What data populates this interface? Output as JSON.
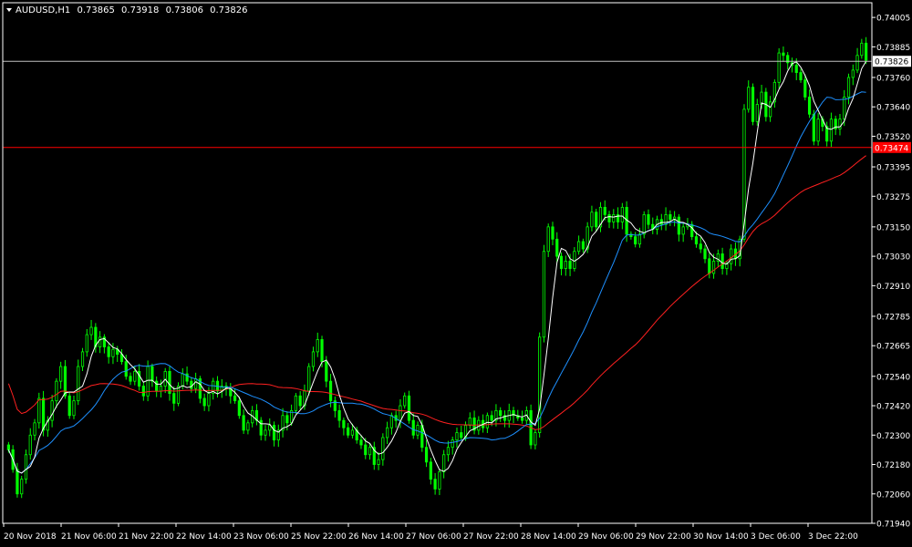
{
  "header": {
    "symbol": "AUDUSD,H1",
    "open": "0.73865",
    "high": "0.73918",
    "low": "0.73806",
    "close": "0.73826"
  },
  "colors": {
    "background": "#000000",
    "frame": "#ffffff",
    "candle": "#00ff00",
    "ma_fast": "#ffffff",
    "ma_mid": "#1e90ff",
    "ma_slow": "#ff2020",
    "hline_current": "#c0c0c0",
    "hline_level": "#ff0000"
  },
  "chart_data": {
    "type": "candlestick",
    "symbol": "AUDUSD",
    "timeframe": "H1",
    "ylim": [
      0.7194,
      0.74065
    ],
    "y_ticks": [
      "0.74005",
      "0.73885",
      "0.73760",
      "0.73640",
      "0.73520",
      "0.73395",
      "0.73275",
      "0.73150",
      "0.73030",
      "0.72910",
      "0.72785",
      "0.72665",
      "0.72540",
      "0.72420",
      "0.72300",
      "0.72180",
      "0.72060",
      "0.71940"
    ],
    "x_ticks": [
      "20 Nov 2018",
      "21 Nov 06:00",
      "21 Nov 22:00",
      "22 Nov 14:00",
      "23 Nov 06:00",
      "25 Nov 22:00",
      "26 Nov 14:00",
      "27 Nov 06:00",
      "27 Nov 22:00",
      "28 Nov 14:00",
      "29 Nov 06:00",
      "29 Nov 22:00",
      "30 Nov 14:00",
      "3 Dec 06:00",
      "3 Dec 22:00"
    ],
    "current_price": "0.73826",
    "level_price": "0.73474",
    "closes": [
      0.7224,
      0.7216,
      0.7206,
      0.7212,
      0.7222,
      0.723,
      0.7235,
      0.7245,
      0.7232,
      0.7236,
      0.7244,
      0.7252,
      0.7258,
      0.7246,
      0.7238,
      0.7244,
      0.7258,
      0.7264,
      0.7271,
      0.7274,
      0.7266,
      0.727,
      0.7266,
      0.7262,
      0.7265,
      0.7263,
      0.726,
      0.7254,
      0.7252,
      0.7256,
      0.725,
      0.7246,
      0.7258,
      0.7252,
      0.7248,
      0.725,
      0.7256,
      0.7247,
      0.7243,
      0.725,
      0.7255,
      0.7252,
      0.7249,
      0.7253,
      0.7245,
      0.7242,
      0.7247,
      0.7252,
      0.7248,
      0.725,
      0.7249,
      0.7246,
      0.7244,
      0.7238,
      0.7232,
      0.7235,
      0.724,
      0.7236,
      0.723,
      0.7232,
      0.7234,
      0.7228,
      0.7232,
      0.7238,
      0.7235,
      0.724,
      0.7246,
      0.7242,
      0.7248,
      0.7258,
      0.7264,
      0.7269,
      0.726,
      0.7252,
      0.7244,
      0.724,
      0.7236,
      0.7233,
      0.723,
      0.7232,
      0.7228,
      0.7226,
      0.7222,
      0.7225,
      0.7218,
      0.722,
      0.7229,
      0.7233,
      0.7238,
      0.7236,
      0.7242,
      0.7246,
      0.7236,
      0.723,
      0.7234,
      0.7225,
      0.7219,
      0.7212,
      0.7208,
      0.7215,
      0.7222,
      0.7225,
      0.7228,
      0.7231,
      0.7229,
      0.7234,
      0.7237,
      0.7232,
      0.7236,
      0.7233,
      0.7238,
      0.7236,
      0.724,
      0.7238,
      0.7236,
      0.724,
      0.7238,
      0.7237,
      0.7236,
      0.724,
      0.7226,
      0.7231,
      0.727,
      0.7305,
      0.7315,
      0.731,
      0.7303,
      0.7298,
      0.7301,
      0.7298,
      0.7305,
      0.7309,
      0.7306,
      0.7315,
      0.7321,
      0.7315,
      0.7323,
      0.732,
      0.7317,
      0.732,
      0.7317,
      0.7323,
      0.7312,
      0.7311,
      0.7308,
      0.7312,
      0.732,
      0.7316,
      0.7314,
      0.7318,
      0.7316,
      0.732,
      0.7318,
      0.7319,
      0.7312,
      0.7315,
      0.7316,
      0.7311,
      0.7308,
      0.7306,
      0.7302,
      0.7296,
      0.7301,
      0.7304,
      0.7298,
      0.73,
      0.7306,
      0.7302,
      0.731,
      0.7363,
      0.7372,
      0.7358,
      0.7365,
      0.737,
      0.736,
      0.7366,
      0.7374,
      0.7386,
      0.7385,
      0.7382,
      0.7381,
      0.7378,
      0.7375,
      0.7368,
      0.7361,
      0.735,
      0.7359,
      0.7356,
      0.735,
      0.7359,
      0.7355,
      0.7359,
      0.7368,
      0.7376,
      0.7379,
      0.7385,
      0.739,
      0.7383
    ]
  }
}
